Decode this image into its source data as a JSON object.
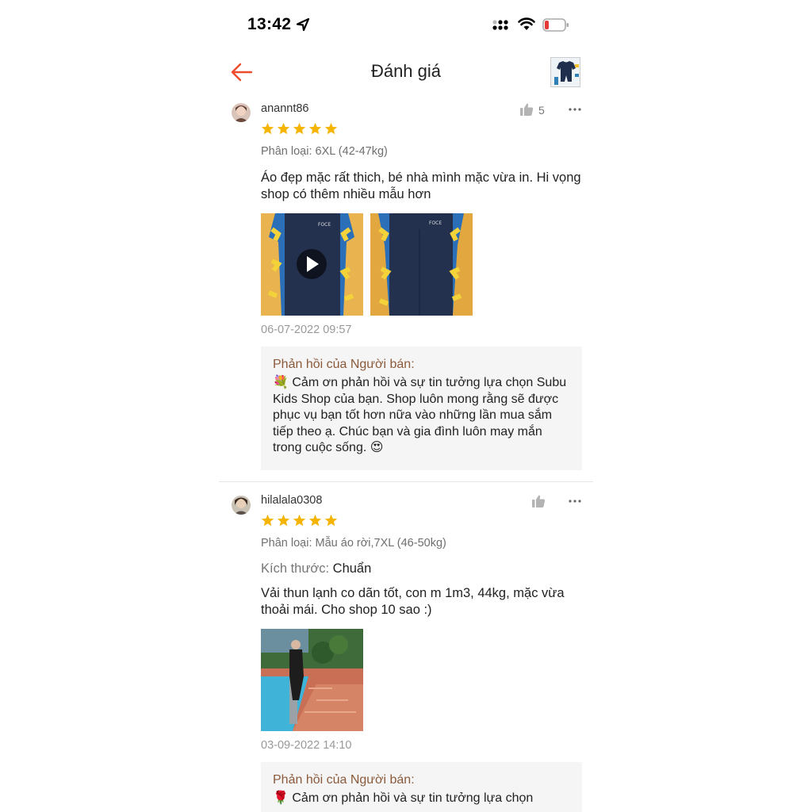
{
  "status_bar": {
    "time": "13:42"
  },
  "header": {
    "title": "Đánh giá"
  },
  "reviews": [
    {
      "username": "anannt86",
      "likes": "5",
      "rating": 5,
      "variant": "Phân loại: 6XL (42-47kg)",
      "comment": "Áo đẹp mặc rất thich, bé nhà mình mặc vừa in. Hi vọng shop có thêm nhiều mẫu hơn",
      "date": "06-07-2022 09:57",
      "reply_title": "Phản hồi của Người bán:",
      "reply_text": "💐 Cảm ơn phản hồi và sự tin tưởng lựa chọn Subu Kids Shop của bạn. Shop luôn mong rằng sẽ được phục vụ bạn tốt hơn nữa vào những lần mua sắm tiếp theo ạ. Chúc bạn và gia đình luôn may mắn trong cuộc sống. 😍"
    },
    {
      "username": "hilalala0308",
      "rating": 5,
      "variant": "Phân loại: Mẫu áo rời,7XL (46-50kg)",
      "size_label": "Kích thước:",
      "size_value": "Chuẩn",
      "comment": "Vải thun lạnh co dãn tốt, con m 1m3, 44kg, mặc vừa thoải mái. Cho shop 10 sao :)",
      "date": "03-09-2022 14:10",
      "reply_title": "Phản hồi của Người bán:",
      "reply_text": "🌹 Cảm ơn phản hồi và sự tin tưởng lựa chọn"
    }
  ],
  "colors": {
    "accent": "#ee4d2d",
    "star": "#f5b400",
    "reply_title": "#8a5a3b"
  }
}
